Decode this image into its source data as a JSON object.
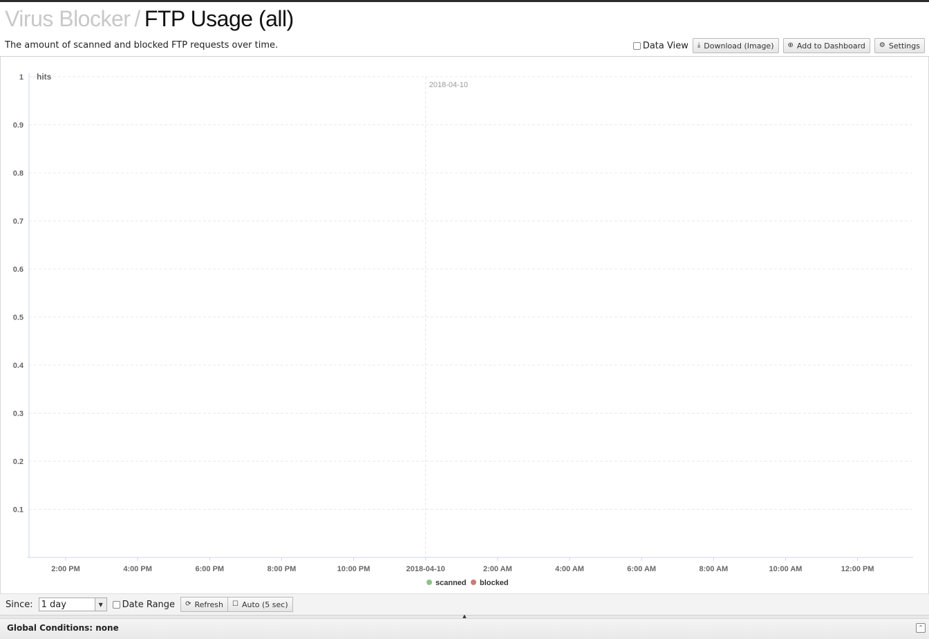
{
  "header": {
    "breadcrumb_parent": "Virus Blocker",
    "separator": "/",
    "title": "FTP Usage (all)",
    "description": "The amount of scanned and blocked FTP requests over time."
  },
  "toolbar": {
    "data_view_label": "Data View",
    "download_label": "Download (Image)",
    "add_dashboard_label": "Add to Dashboard",
    "settings_label": "Settings"
  },
  "chart_data": {
    "type": "line",
    "ylabel": "hits",
    "ylim": [
      0,
      1
    ],
    "yticks": [
      "0.1",
      "0.2",
      "0.3",
      "0.4",
      "0.5",
      "0.6",
      "0.7",
      "0.8",
      "0.9",
      "1"
    ],
    "xticks": [
      "2:00 PM",
      "4:00 PM",
      "6:00 PM",
      "8:00 PM",
      "10:00 PM",
      "2018-04-10",
      "2:00 AM",
      "4:00 AM",
      "6:00 AM",
      "8:00 AM",
      "10:00 AM",
      "12:00 PM"
    ],
    "plotline_label": "2018-04-10",
    "series": [
      {
        "name": "scanned",
        "color": "#90c18a",
        "values": []
      },
      {
        "name": "blocked",
        "color": "#c97a7a",
        "values": []
      }
    ],
    "grid": true,
    "legend_position": "bottom-center"
  },
  "controls": {
    "since_label": "Since:",
    "since_value": "1 day",
    "date_range_label": "Date Range",
    "refresh_label": "Refresh",
    "auto_label": "Auto (5 sec)"
  },
  "footer": {
    "global_conditions": "Global Conditions: none"
  }
}
